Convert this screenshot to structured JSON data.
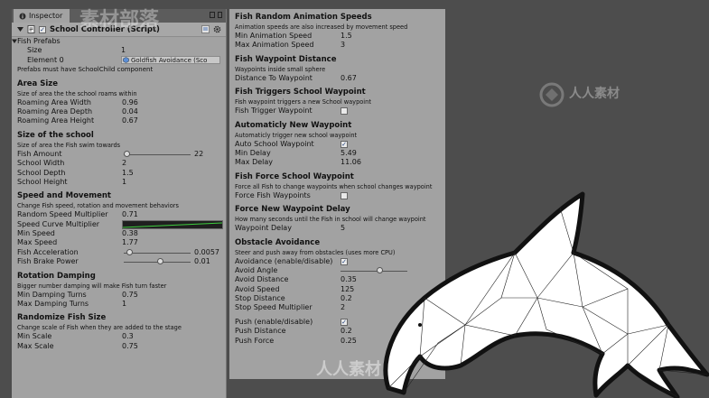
{
  "inspector": {
    "tab_label": "Inspector",
    "component_title": "School Controller (Script)",
    "fish_prefabs_label": "Fish Prefabs",
    "size_label": "Size",
    "size_value": "1",
    "element0_label": "Element 0",
    "element0_value": "Goldfish Avoidance (Sco",
    "prefabs_note": "Prefabs must have SchoolChild component"
  },
  "area_size": {
    "title": "Area Size",
    "desc": "Size of area the the school roams within",
    "rows": [
      {
        "label": "Roaming Area Width",
        "value": "0.96"
      },
      {
        "label": "Roaming Area Depth",
        "value": "0.04"
      },
      {
        "label": "Roaming Area Height",
        "value": "0.67"
      }
    ]
  },
  "school_size": {
    "title": "Size of the school",
    "desc": "Size of area the Fish swim towards",
    "fish_amount_label": "Fish Amount",
    "fish_amount_value": "22",
    "rows": [
      {
        "label": "School Width",
        "value": "2"
      },
      {
        "label": "School Depth",
        "value": "1.5"
      },
      {
        "label": "School Height",
        "value": "1"
      }
    ]
  },
  "speed": {
    "title": "Speed and Movement",
    "desc": "Change Fish speed, rotation and movement behaviors",
    "random_label": "Random Speed Multiplier",
    "random_value": "0.71",
    "curve_label": "Speed Curve Multiplier",
    "min_label": "Min Speed",
    "min_value": "0.38",
    "max_label": "Max Speed",
    "max_value": "1.77",
    "accel_label": "Fish Acceleration",
    "accel_value": "0.0057",
    "accel_level": 0.05,
    "brake_label": "Fish Brake Power",
    "brake_value": "0.01",
    "brake_level": 0.55
  },
  "rotation": {
    "title": "Rotation Damping",
    "desc": "Bigger number damping will make Fish turn faster",
    "rows": [
      {
        "label": "Min Damping Turns",
        "value": "0.75"
      },
      {
        "label": "Max Damping Turns",
        "value": "1"
      }
    ]
  },
  "randomize": {
    "title": "Randomize Fish Size",
    "desc": "Change scale of Fish when they are added to the stage",
    "rows": [
      {
        "label": "Min Scale",
        "value": "0.3"
      },
      {
        "label": "Max Scale",
        "value": "0.75"
      }
    ]
  },
  "anim": {
    "title": "Fish Random Animation Speeds",
    "desc": "Animation speeds are also increased by movement speed",
    "rows": [
      {
        "label": "Min Animation Speed",
        "value": "1.5"
      },
      {
        "label": "Max Animation Speed",
        "value": "3"
      }
    ]
  },
  "waypoint_distance": {
    "title": "Fish Waypoint Distance",
    "desc": "Waypoints inside small sphere",
    "label": "Distance To Waypoint",
    "value": "0.67"
  },
  "triggers": {
    "title": "Fish Triggers School Waypoint",
    "desc": "Fish waypoint triggers a new School waypoint",
    "label": "Fish Trigger Waypoint",
    "checked": false
  },
  "auto_waypoint": {
    "title": "Automaticly New Waypoint",
    "desc": "Automaticly trigger new school waypoint",
    "auto_label": "Auto School Waypoint",
    "auto_checked": true,
    "min_label": "Min Delay",
    "min_value": "5.49",
    "max_label": "Max Delay",
    "max_value": "11.06"
  },
  "force_school": {
    "title": "Fish Force School Waypoint",
    "desc": "Force all Fish to change waypoints when school changes waypoint",
    "label": "Force Fish Waypoints",
    "checked": false
  },
  "force_delay": {
    "title": "Force New Waypoint Delay",
    "desc": "How many seconds until the Fish in school will change waypoint",
    "label": "Waypoint Delay",
    "value": "5"
  },
  "avoidance": {
    "title": "Obstacle Avoidance",
    "desc": "Steer and push away from obstacles (uses more CPU)",
    "enable_label": "Avoidance (enable/disable)",
    "enable_checked": true,
    "rows": [
      {
        "label": "Avoid Angle",
        "value": ""
      },
      {
        "label": "Avoid Distance",
        "value": "0.35"
      },
      {
        "label": "Avoid Speed",
        "value": "125"
      },
      {
        "label": "Stop Distance",
        "value": "0.2"
      },
      {
        "label": "Stop Speed Multiplier",
        "value": "2"
      }
    ],
    "push_label": "Push (enable/disable)",
    "push_checked": true,
    "push_rows": [
      {
        "label": "Push Distance",
        "value": "0.2"
      },
      {
        "label": "Push Force",
        "value": "0.25"
      }
    ]
  },
  "colors": {
    "panel": "#a2a2a2",
    "background": "#4d4d4d",
    "curve": "#3ecc3e",
    "check": "#1f3f7a"
  }
}
